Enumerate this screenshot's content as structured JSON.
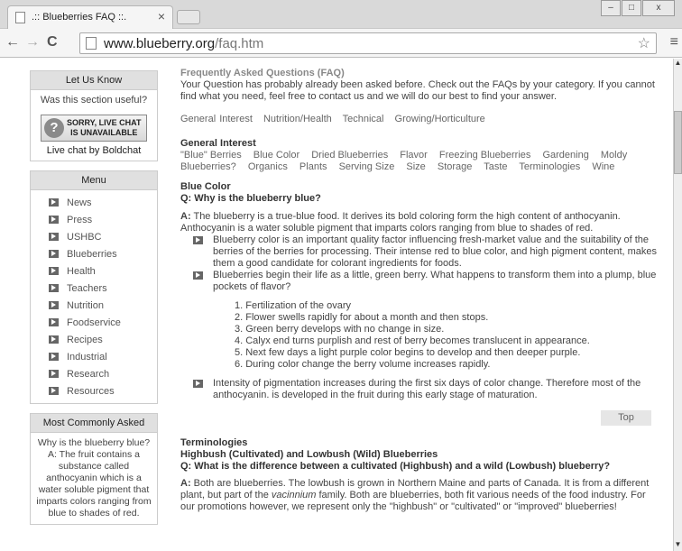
{
  "browser": {
    "tab_title": ".:: Blueberries FAQ ::.",
    "close_tab": "×",
    "url_host": "www.blueberry.org",
    "url_path": "/faq.htm",
    "window_buttons": [
      "–",
      "□",
      "x"
    ]
  },
  "sidebar": {
    "letusknow": {
      "title": "Let Us Know",
      "question": "Was this section useful?",
      "chat_line1": "SORRY, LIVE CHAT",
      "chat_line2": "IS UNAVAILABLE",
      "chat_by": "Live chat by Boldchat"
    },
    "menu": {
      "title": "Menu",
      "items": [
        "News",
        "Press",
        "USHBC",
        "Blueberries",
        "Health",
        "Teachers",
        "Nutrition",
        "Foodservice",
        "Recipes",
        "Industrial",
        "Research",
        "Resources"
      ]
    },
    "most_asked": {
      "title": "Most Commonly Asked",
      "text": "Why is the blueberry blue? A: The fruit contains a substance called anthocyanin which is a water soluble pigment that imparts colors ranging from blue to shades of red."
    }
  },
  "main": {
    "title": "Frequently Asked Questions (FAQ)",
    "intro": "Your Question has probably already been asked before.  Check out the FAQs by your category.  If you cannot find what you need, feel free to contact us and we will do our best to find your answer.",
    "topics": [
      "General Interest",
      "Nutrition/Health",
      "Technical",
      "Growing/Horticulture"
    ],
    "general_heading": "General Interest",
    "general_tags": [
      "\"Blue\" Berries",
      "Blue Color",
      "Dried Blueberries",
      "Flavor",
      "Freezing Blueberries",
      "Gardening",
      "Moldy Blueberries?",
      "Organics",
      "Plants",
      "Serving Size",
      "Size",
      "Storage",
      "Taste",
      "Terminologies",
      "Wine"
    ],
    "section1_heading": "Blue Color",
    "section1_q": "Q: Why is the blueberry blue?",
    "section1_a_label": "A:",
    "section1_a": "The blueberry is a true-blue food. It derives its bold coloring form the high content of anthocyanin. Anthocyanin is a water soluble pigment that imparts colors ranging from blue to shades of red.",
    "bullets": [
      "Blueberry color is an important quality factor influencing fresh-market value and the suitability of the berries of the berries for processing. Their intense red to blue color, and high pigment content, makes them a good candidate for colorant ingredients for foods.",
      "Blueberries begin their life as a little, green berry. What happens to transform them into a plump, blue pockets of flavor?"
    ],
    "steps": [
      "1.  Fertilization of the ovary",
      "2.  Flower swells rapidly for about a month and then stops.",
      "3.  Green berry develops with no change in size.",
      "4.  Calyx end turns purplish and rest of berry becomes translucent in appearance.",
      "5.  Next few days a light purple color begins to develop and then deeper purple.",
      "6.  During color change the berry volume increases rapidly."
    ],
    "bullet3": "Intensity of pigmentation increases during the first six days of color change. Therefore most of the anthocyanin. is developed in the fruit during this early stage of maturation.",
    "top_label": "Top",
    "section2_heading": "Terminologies",
    "section2_subheading": "Highbush (Cultivated) and Lowbush (Wild) Blueberries",
    "section2_q": "Q: What is the difference between a cultivated (Highbush)  and a wild  (Lowbush) blueberry?",
    "section2_a_label": "A:",
    "section2_a1": "Both are blueberries. The lowbush is grown in Northern Maine and parts of Canada. It is from a different plant, but part of the ",
    "section2_a_italic": "vacinnium",
    "section2_a2": " family. Both are blueberries, both fit various needs of the food industry. For our promotions however, we represent only the \"highbush\" or \"cultivated\" or \"improved\" blueberries!"
  }
}
